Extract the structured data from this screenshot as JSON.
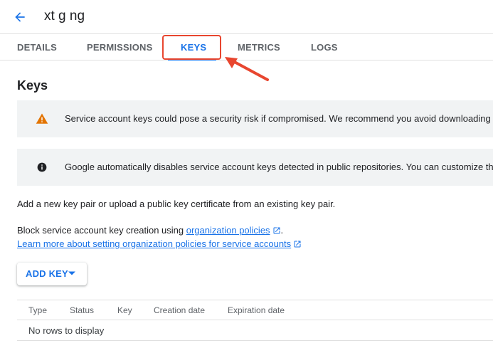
{
  "header": {
    "title": "xt g ng"
  },
  "tabs": [
    {
      "label": "DETAILS",
      "active": false
    },
    {
      "label": "PERMISSIONS",
      "active": false
    },
    {
      "label": "KEYS",
      "active": true
    },
    {
      "label": "METRICS",
      "active": false
    },
    {
      "label": "LOGS",
      "active": false
    }
  ],
  "section": {
    "title": "Keys"
  },
  "banners": {
    "warning": {
      "icon": "warning-icon",
      "text": "Service account keys could pose a security risk if compromised. We recommend you avoid downloading"
    },
    "info": {
      "icon": "info-icon",
      "text": "Google automatically disables service account keys detected in public repositories. You can customize th"
    }
  },
  "content": {
    "intro": "Add a new key pair or upload a public key certificate from an existing key pair.",
    "block_prefix": "Block service account key creation using",
    "block_link": "organization policies",
    "block_suffix": ".",
    "learn_more_link": "Learn more about setting organization policies for service accounts"
  },
  "add_key": {
    "label": "ADD KEY"
  },
  "table": {
    "columns": [
      "Type",
      "Status",
      "Key",
      "Creation date",
      "Expiration date"
    ],
    "empty_message": "No rows to display"
  },
  "colors": {
    "accent": "#1a73e8",
    "warning": "#e37400",
    "annotation": "#e8462f",
    "banner_bg": "#f1f3f4"
  }
}
